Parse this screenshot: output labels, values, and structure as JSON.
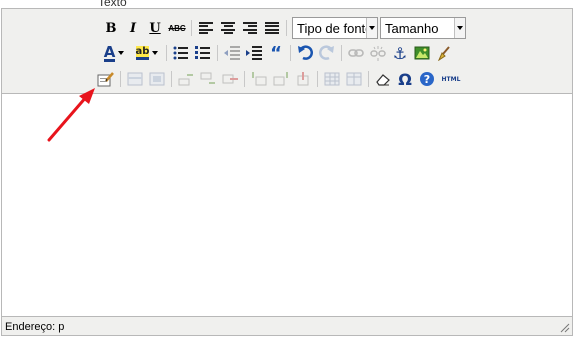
{
  "field_label": "Texto",
  "toolbar": {
    "row1": {
      "bold": "B",
      "italic": "I",
      "underline": "U",
      "strikethrough": "ABC",
      "font_select": "Tipo de fonte",
      "size_select": "Tamanho"
    },
    "row2": {
      "font_color": "A",
      "highlight_color": "ab",
      "blockquote": "“",
      "anchor": "⚓"
    },
    "row3": {
      "omega": "Ω",
      "help": "?",
      "html": "HTML"
    }
  },
  "status_bar": {
    "path_label": "Endereço: p"
  },
  "annotation_color": "#e8141c"
}
